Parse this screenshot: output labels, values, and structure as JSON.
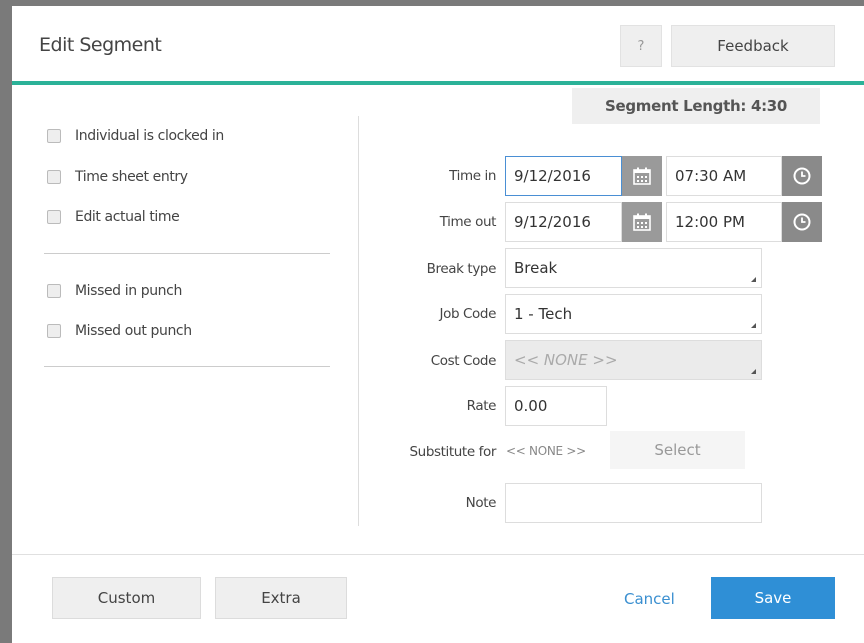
{
  "header": {
    "title": "Edit Segment",
    "help_label": "?",
    "feedback_label": "Feedback"
  },
  "segment_length": "Segment Length: 4:30",
  "checkboxes": [
    {
      "label": "Individual is clocked in",
      "checked": false
    },
    {
      "label": "Time sheet entry",
      "checked": false
    },
    {
      "label": "Edit actual time",
      "checked": false
    },
    {
      "label": "Missed in punch",
      "checked": false
    },
    {
      "label": "Missed out punch",
      "checked": false
    }
  ],
  "form": {
    "time_in": {
      "label": "Time in",
      "date": "9/12/2016",
      "time": "07:30 AM"
    },
    "time_out": {
      "label": "Time out",
      "date": "9/12/2016",
      "time": "12:00 PM"
    },
    "break_type": {
      "label": "Break type",
      "value": "Break"
    },
    "job_code": {
      "label": "Job Code",
      "value": "1 - Tech"
    },
    "cost_code": {
      "label": "Cost Code",
      "value": "<< NONE >>"
    },
    "rate": {
      "label": "Rate",
      "value": "0.00"
    },
    "substitute": {
      "label": "Substitute for",
      "value": "<< NONE >>",
      "select_label": "Select"
    },
    "note": {
      "label": "Note",
      "value": ""
    }
  },
  "footer": {
    "custom_label": "Custom",
    "extra_label": "Extra",
    "cancel_label": "Cancel",
    "save_label": "Save"
  },
  "colors": {
    "accent": "#2bb298",
    "primary": "#2f8fd6",
    "link": "#3a8fd0"
  }
}
